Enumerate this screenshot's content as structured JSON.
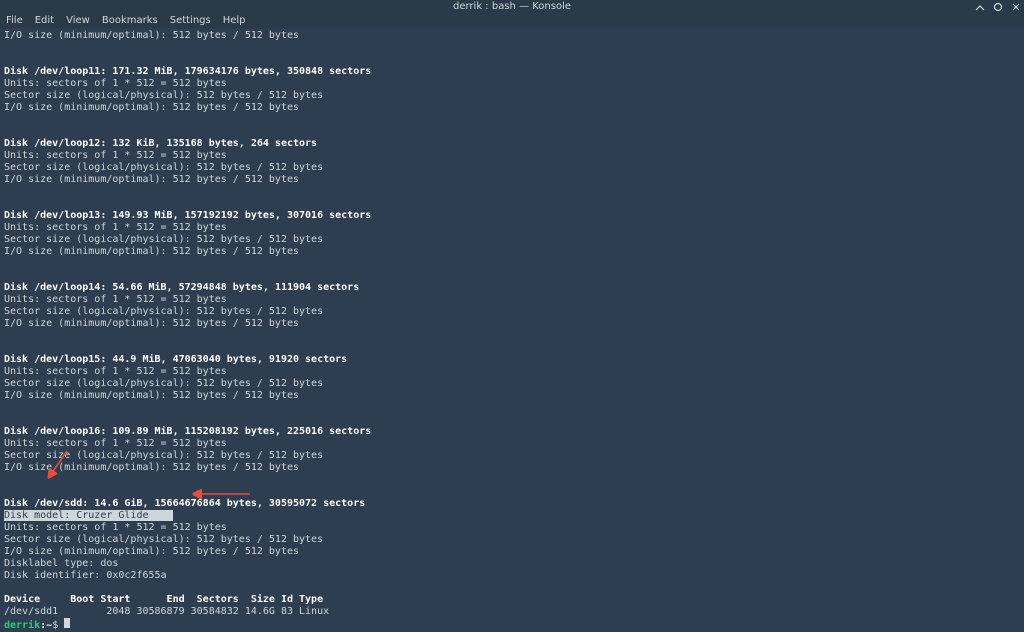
{
  "window": {
    "title": "derrik : bash — Konsole"
  },
  "menu": {
    "file": "File",
    "edit": "Edit",
    "view": "View",
    "bookmarks": "Bookmarks",
    "settings": "Settings",
    "help": "Help"
  },
  "block0": {
    "io": "I/O size (minimum/optimal): 512 bytes / 512 bytes"
  },
  "disk11": {
    "header": "Disk /dev/loop11: 171.32 MiB, 179634176 bytes, 350848 sectors",
    "units": "Units: sectors of 1 * 512 = 512 bytes",
    "sector": "Sector size (logical/physical): 512 bytes / 512 bytes",
    "io": "I/O size (minimum/optimal): 512 bytes / 512 bytes"
  },
  "disk12": {
    "header": "Disk /dev/loop12: 132 KiB, 135168 bytes, 264 sectors",
    "units": "Units: sectors of 1 * 512 = 512 bytes",
    "sector": "Sector size (logical/physical): 512 bytes / 512 bytes",
    "io": "I/O size (minimum/optimal): 512 bytes / 512 bytes"
  },
  "disk13": {
    "header": "Disk /dev/loop13: 149.93 MiB, 157192192 bytes, 307016 sectors",
    "units": "Units: sectors of 1 * 512 = 512 bytes",
    "sector": "Sector size (logical/physical): 512 bytes / 512 bytes",
    "io": "I/O size (minimum/optimal): 512 bytes / 512 bytes"
  },
  "disk14": {
    "header": "Disk /dev/loop14: 54.66 MiB, 57294848 bytes, 111904 sectors",
    "units": "Units: sectors of 1 * 512 = 512 bytes",
    "sector": "Sector size (logical/physical): 512 bytes / 512 bytes",
    "io": "I/O size (minimum/optimal): 512 bytes / 512 bytes"
  },
  "disk15": {
    "header": "Disk /dev/loop15: 44.9 MiB, 47063040 bytes, 91920 sectors",
    "units": "Units: sectors of 1 * 512 = 512 bytes",
    "sector": "Sector size (logical/physical): 512 bytes / 512 bytes",
    "io": "I/O size (minimum/optimal): 512 bytes / 512 bytes"
  },
  "disk16": {
    "header": "Disk /dev/loop16: 109.89 MiB, 115208192 bytes, 225016 sectors",
    "units": "Units: sectors of 1 * 512 = 512 bytes",
    "sector": "Sector size (logical/physical): 512 bytes / 512 bytes",
    "io": "I/O size (minimum/optimal): 512 bytes / 512 bytes"
  },
  "disksdd": {
    "header": "Disk /dev/sdd: 14.6 GiB, 15664676864 bytes, 30595072 sectors",
    "model": "Disk model: Cruzer Glide    ",
    "units": "Units: sectors of 1 * 512 = 512 bytes",
    "sector": "Sector size (logical/physical): 512 bytes / 512 bytes",
    "io": "I/O size (minimum/optimal): 512 bytes / 512 bytes",
    "dlt": "Disklabel type: dos",
    "did": "Disk identifier: 0x0c2f655a"
  },
  "ptable": {
    "head": "Device     Boot Start      End  Sectors  Size Id Type",
    "row": "/dev/sdd1        2048 30586879 30584832 14.6G 83 Linux"
  },
  "prompt": {
    "user": "derrik",
    "sep": ":",
    "path": "~",
    "dollar": "$ "
  }
}
